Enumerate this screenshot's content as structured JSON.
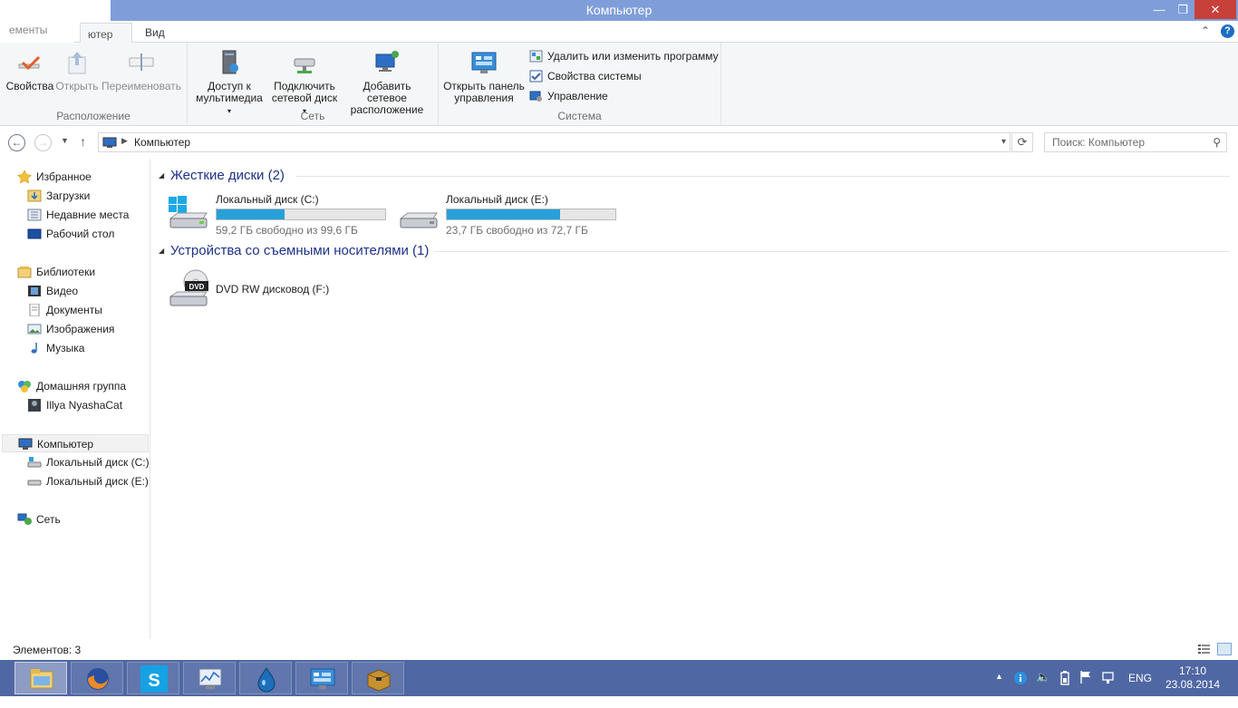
{
  "window": {
    "title": "Компьютер",
    "minimize_glyph": "—",
    "maximize_glyph": "❐",
    "close_glyph": "✕"
  },
  "tabs": {
    "file": "ементы",
    "computer": "ютер",
    "view": "Вид"
  },
  "ribbon": {
    "location": {
      "label": "Расположение",
      "properties": "Свойства",
      "open": "Открыть",
      "rename": "Переименовать"
    },
    "network": {
      "label": "Сеть",
      "media_line1": "Доступ к",
      "media_line2": "мультимедиа",
      "map_line1": "Подключить",
      "map_line2": "сетевой диск",
      "add_line1": "Добавить сетевое",
      "add_line2": "расположение"
    },
    "system": {
      "label": "Система",
      "cp_line1": "Открыть панель",
      "cp_line2": "управления",
      "uninstall": "Удалить или изменить программу",
      "sysprops": "Свойства системы",
      "manage": "Управление"
    }
  },
  "address": {
    "crumb": "Компьютер",
    "search_placeholder": "Поиск: Компьютер"
  },
  "nav": {
    "favorites": "Избранное",
    "downloads": "Загрузки",
    "recent": "Недавние места",
    "desktop": "Рабочий стол",
    "libraries": "Библиотеки",
    "video": "Видео",
    "documents": "Документы",
    "pictures": "Изображения",
    "music": "Музыка",
    "homegroup": "Домашняя группа",
    "user": "Illya NyashaCat",
    "computer": "Компьютер",
    "disk_c": "Локальный диск (C:)",
    "disk_e": "Локальный диск (E:)",
    "network": "Сеть"
  },
  "groups": {
    "hdd": "Жесткие диски (2)",
    "removable": "Устройства со съемными носителями (1)"
  },
  "drives": [
    {
      "name": "Локальный диск (C:)",
      "free": "59,2 ГБ свободно из 99,6 ГБ",
      "used_fraction": 0.405
    },
    {
      "name": "Локальный диск (E:)",
      "free": "23,7 ГБ свободно из 72,7 ГБ",
      "used_fraction": 0.674
    }
  ],
  "dvd": {
    "name": "DVD RW дисковод (F:)",
    "badge": "DVD"
  },
  "status": {
    "items": "Элементов: 3"
  },
  "tray": {
    "lang": "ENG",
    "time": "17:10",
    "date": "23.08.2014"
  },
  "colors": {
    "titlebar": "#7f9ed9",
    "taskbar": "#4f67a3",
    "progress": "#26a0da",
    "close": "#c7403a"
  }
}
